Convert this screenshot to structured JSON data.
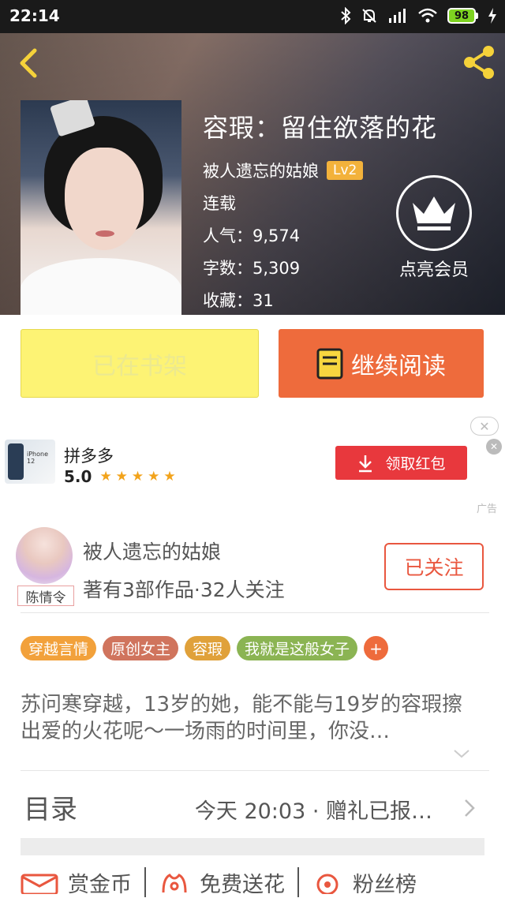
{
  "status_bar": {
    "time": "22:14",
    "battery": "98",
    "network": "HD"
  },
  "colors": {
    "accent_orange": "#ee6b3c",
    "shelf_yellow": "#fdf374",
    "ad_red": "#e8383d",
    "follow_red": "#e9573f"
  },
  "header": {
    "back_icon": "back-chevron-icon",
    "share_icon": "share-icon"
  },
  "book": {
    "title": "容瑕：留住欲落的花",
    "author": "被人遗忘的姑娘",
    "level": "Lv2",
    "status": "连载",
    "popularity": "人气：9,574",
    "word_count": "字数：5,309",
    "favorites": "收藏：31"
  },
  "vip": {
    "label": "点亮会员",
    "icon": "crown-icon"
  },
  "actions": {
    "shelf_label": "已在书架",
    "read_label": "继续阅读",
    "read_icon": "book-icon"
  },
  "ad": {
    "app_name": "拼多多",
    "rating": "5.0",
    "button_label": "领取红包",
    "thumb_text": "iPhone 12",
    "ad_tag": "广告",
    "close_icon": "close-icon"
  },
  "author_section": {
    "name": "被人遗忘的姑娘",
    "stats": "著有3部作品·32人关注",
    "avatar_tag": "陈情令",
    "follow_label": "已关注"
  },
  "tags": [
    {
      "label": "穿越言情",
      "color": "#f2a13b"
    },
    {
      "label": "原创女主",
      "color": "#d0745d"
    },
    {
      "label": "容瑕",
      "color": "#e0a13a"
    },
    {
      "label": "我就是这般女子",
      "color": "#8bb453"
    }
  ],
  "tag_add": "+",
  "description": "苏问寒穿越，13岁的她，能不能与19岁的容瑕擦出爱的火花呢～一场雨的时间里，你没…",
  "toc": {
    "label": "目录",
    "latest": "今天 20:03 · 赠礼已报…"
  },
  "bottom_bar": [
    {
      "label": "赏金币",
      "icon": "coin-envelope-icon"
    },
    {
      "label": "免费送花",
      "icon": "flower-icon"
    },
    {
      "label": "粉丝榜",
      "icon": "fan-rank-icon"
    }
  ]
}
